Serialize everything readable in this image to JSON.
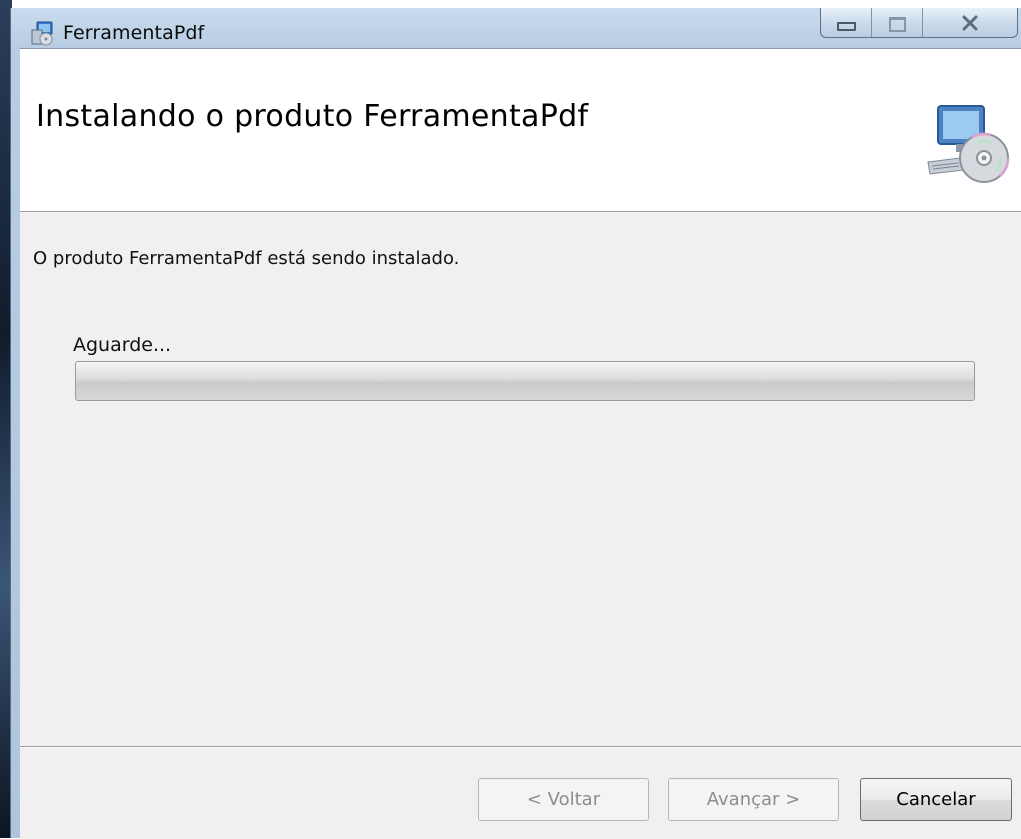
{
  "window": {
    "title": "FerramentaPdf",
    "controls": {
      "minimize_icon": "minimize-icon",
      "maximize_icon": "maximize-icon",
      "close_glyph": "⅏"
    }
  },
  "banner": {
    "title": "Instalando o produto FerramentaPdf",
    "icon": "computer-with-disc-icon"
  },
  "body": {
    "status": "O produto FerramentaPdf está sendo instalado.",
    "wait_label": "Aguarde...",
    "progress": 0
  },
  "buttons": {
    "back": "< Voltar",
    "next": "Avançar >",
    "cancel": "Cancelar"
  },
  "colors": {
    "client_bg": "#f0f0f0",
    "banner_bg": "#ffffff",
    "titlebar": "#b8cde3"
  }
}
